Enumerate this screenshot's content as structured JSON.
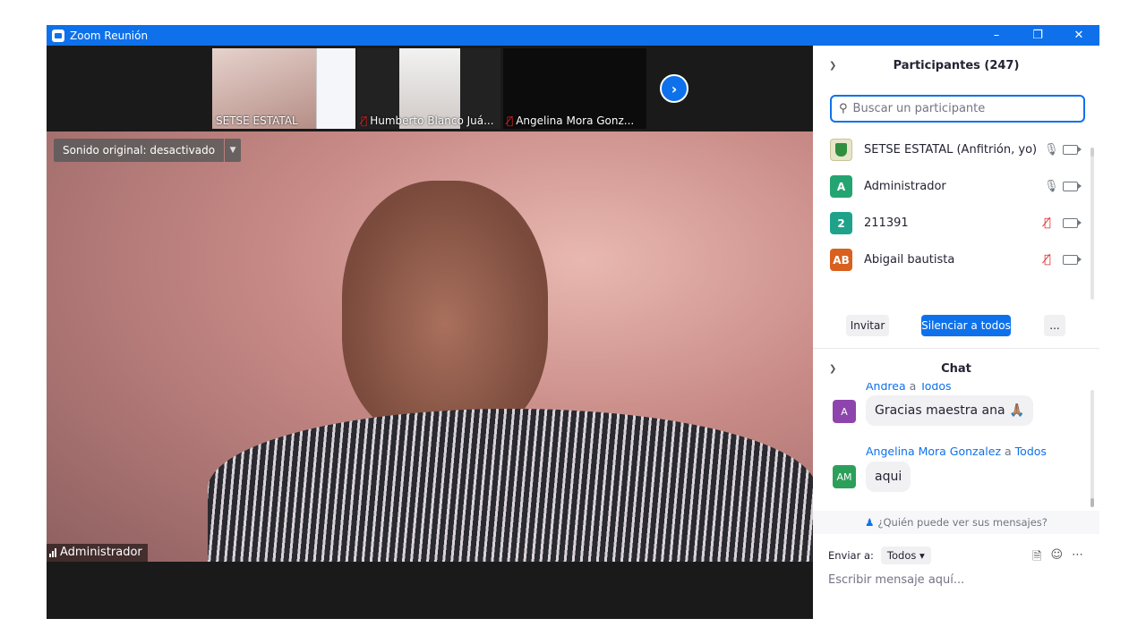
{
  "window": {
    "title": "Zoom Reunión",
    "controls": [
      "minimize-icon",
      "restore-icon",
      "close-icon"
    ]
  },
  "thumbnails": [
    {
      "name": "SETSE ESTATAL",
      "muted": false
    },
    {
      "name": "Humberto Blanco Juá...",
      "muted": true
    },
    {
      "name": "Angelina Mora Gonz...",
      "muted": true
    }
  ],
  "main_video": {
    "sound_label": "Sonido original: desactivado",
    "speaker": "Administrador"
  },
  "participants": {
    "header": "Participantes (247)",
    "search_placeholder": "Buscar un participante",
    "items": [
      {
        "initials": "",
        "name": "SETSE ESTATAL (Anfitrión, yo)",
        "muted": false,
        "color": "#e8e6c9"
      },
      {
        "initials": "A",
        "name": "Administrador",
        "muted": false,
        "color": "#23a471"
      },
      {
        "initials": "2",
        "name": "211391",
        "muted": true,
        "color": "#1ea38a"
      },
      {
        "initials": "AB",
        "name": "Abigail bautista",
        "muted": true,
        "color": "#d9601f"
      }
    ],
    "buttons": {
      "invite": "Invitar",
      "mute_all": "Silenciar a todos",
      "more": "..."
    }
  },
  "chat": {
    "header": "Chat",
    "messages": [
      {
        "avatar": "A",
        "avatar_color": "#8e44ad",
        "sender": "Andrea",
        "to_word": "a",
        "to": "Todos",
        "text": "Gracias maestra ana 🙏🏽"
      },
      {
        "avatar": "AM",
        "avatar_color": "#2ca05a",
        "sender": "Angelina Mora Gonzalez",
        "to_word": "a",
        "to": "Todos",
        "text": "aqui"
      }
    ],
    "who_can_see": "¿Quién puede ver sus mensajes?",
    "send_to_label": "Enviar a:",
    "send_to_value": "Todos",
    "compose_placeholder": "Escribir mensaje aquí..."
  },
  "colors": {
    "accent": "#0e71eb",
    "muted_mic": "#e02828"
  }
}
